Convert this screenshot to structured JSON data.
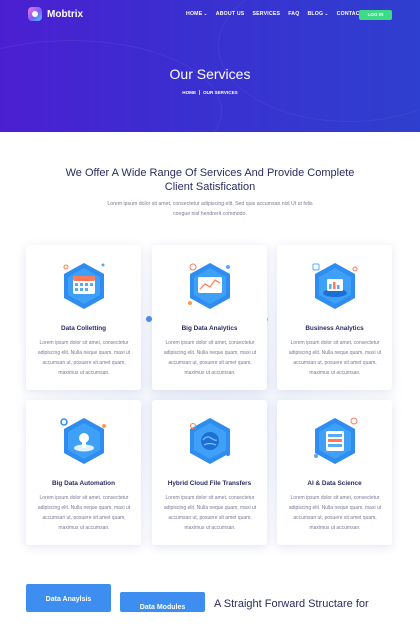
{
  "brand": {
    "name": "Mobtrix"
  },
  "nav": {
    "items": [
      "HOME",
      "ABOUT US",
      "SERVICES",
      "FAQ",
      "BLOG",
      "CONTACT"
    ],
    "login": "LOG IN"
  },
  "hero": {
    "title": "Our Services",
    "breadcrumb": [
      "HOME",
      "OUR SERVICES"
    ]
  },
  "intro": {
    "title": "We Offer A Wide Range Of Services And Provide Complete Client Satisfication",
    "text": "Lorem ipsum dolor sit amet, consectetur adipiscing elit. Sed quis accumsan nisl Ut ut felis congue nisl hendrerit commodo."
  },
  "services": [
    {
      "title": "Data Colletting",
      "icon": "data-collecting-icon",
      "text": "Lorem ipsum dolor sit amet, consectetur adipiscing elit. Nulla neque quam, maxi ut accumsan ut, posuere sit amet quam, maximus ut accumsan."
    },
    {
      "title": "Big Data Analytics",
      "icon": "big-data-analytics-icon",
      "text": "Lorem ipsum dolor sit amet, consectetur adipiscing elit. Nulla neque quam, maxi ut accumsan ut, posuere sit amet quam, maximus ut accumsan."
    },
    {
      "title": "Business Analytics",
      "icon": "business-analytics-icon",
      "text": "Lorem ipsum dolor sit amet, consectetur adipiscing elit. Nulla neque quam, maxi ut accumsan ut, posuere sit amet quam, maximus ut accumsan."
    },
    {
      "title": "Big Data Automation",
      "icon": "big-data-automation-icon",
      "text": "Lorem ipsum dolor sit amet, consectetur adipiscing elit. Nulla neque quam, maxi ut accumsan ut, posuere sit amet quam, maximus ut accumsan."
    },
    {
      "title": "Hybrid Cloud File Transfers",
      "icon": "hybrid-cloud-icon",
      "text": "Lorem ipsum dolor sit amet, consectetur adipiscing elit. Nulla neque quam, maxi ut accumsan ut, posuere sit amet quam, maximus ut accumsan."
    },
    {
      "title": "AI & Data Science",
      "icon": "ai-data-science-icon",
      "text": "Lorem ipsum dolor sit amet, consectetur adipiscing elit. Nulla neque quam, maxi ut accumsan ut, posuere sit amet quam, maximus ut accumsan."
    }
  ],
  "bottom": {
    "tab_analysis": "Data Anaylsis",
    "tab_modules": "Data Modules",
    "heading": "A Straight Forward Structare for"
  },
  "colors": {
    "hero_start": "#4b1fd1",
    "hero_end": "#2f3fcf",
    "login": "#3ddc84",
    "accent_blue": "#3d8ef0",
    "heading": "#2b2b63"
  }
}
